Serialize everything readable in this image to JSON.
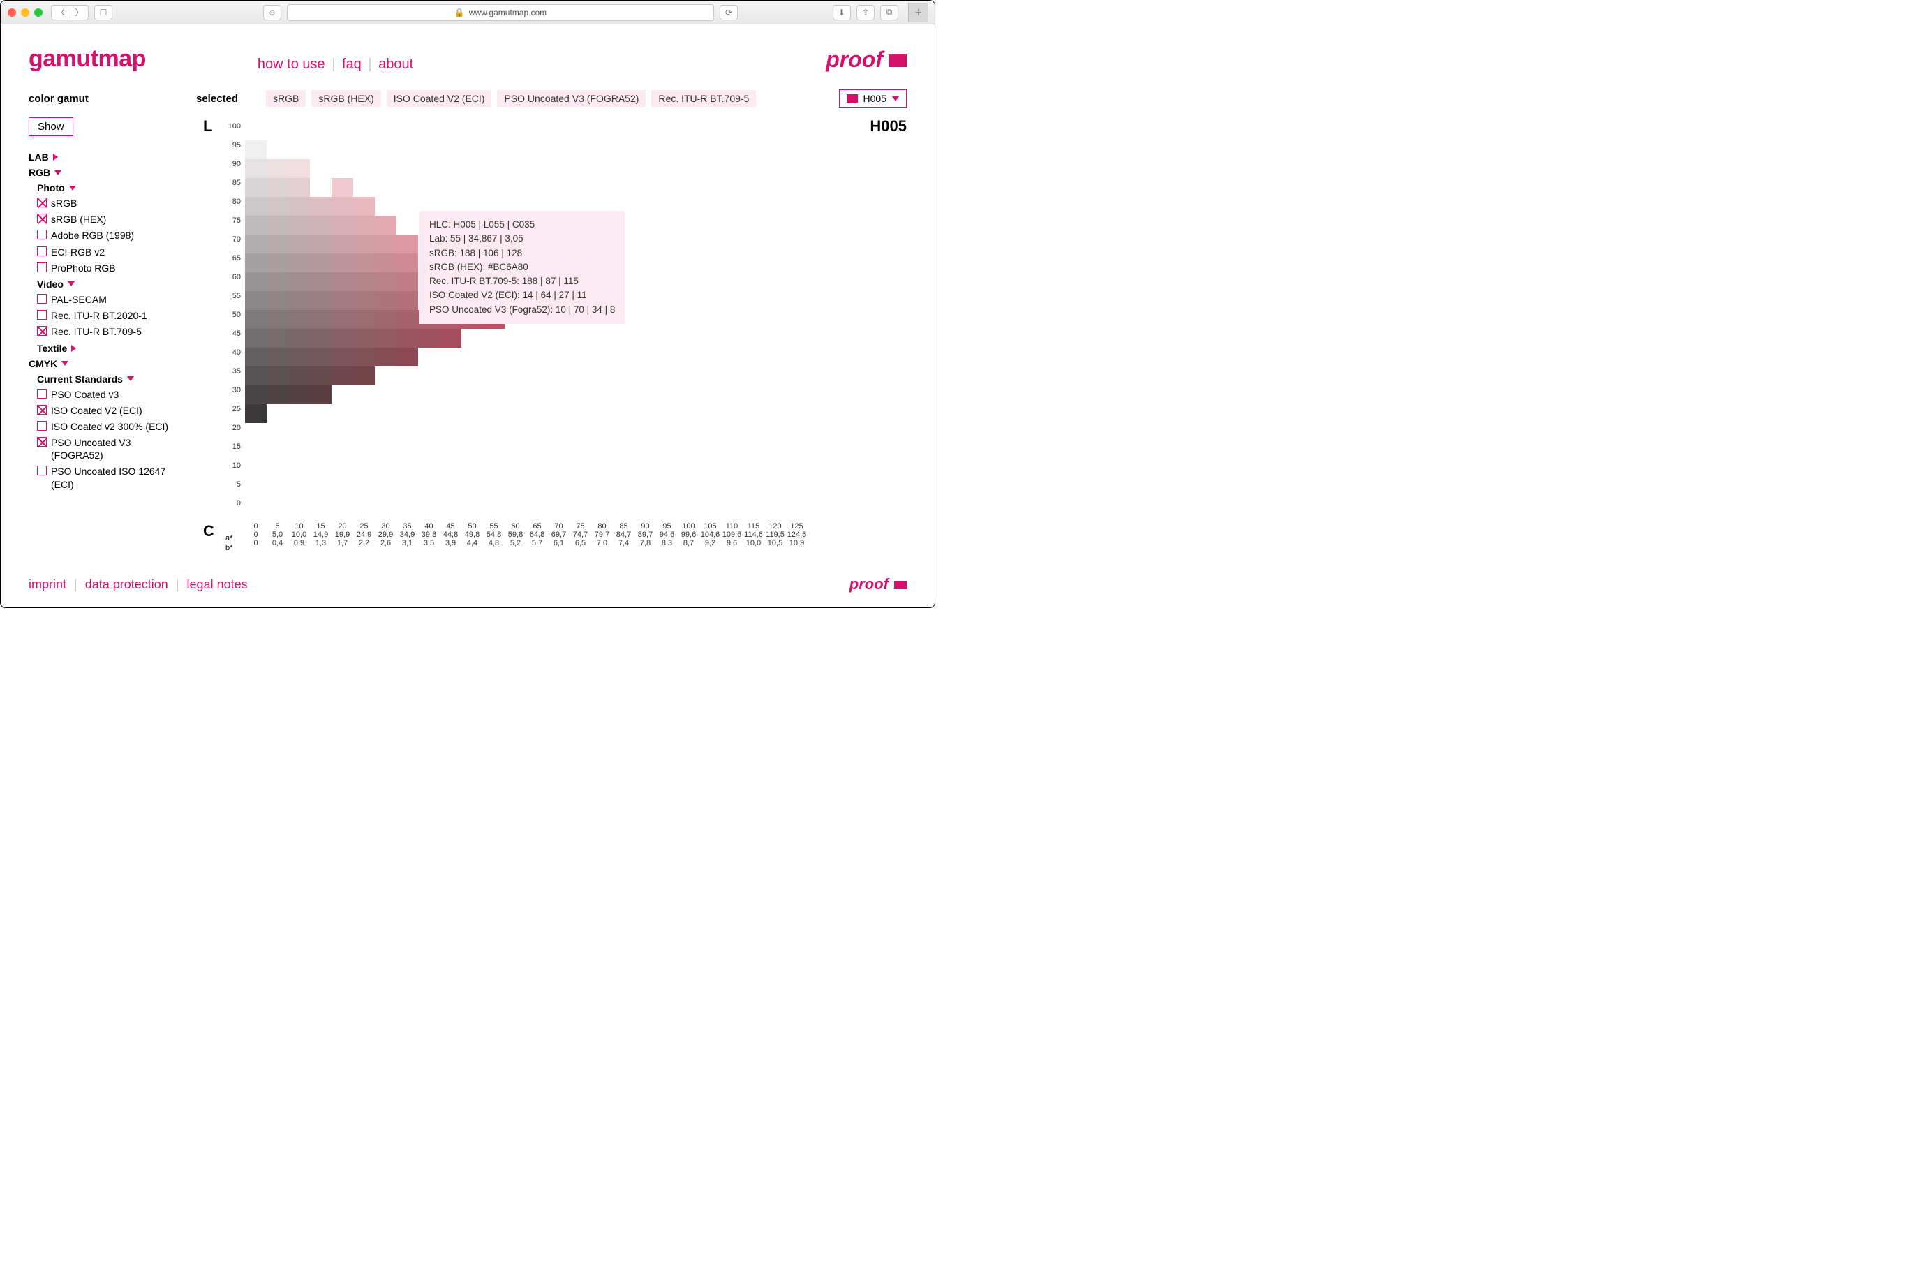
{
  "browser": {
    "url_label": "www.gamutmap.com"
  },
  "header": {
    "logo": "gamutmap",
    "nav": {
      "how": "how to use",
      "faq": "faq",
      "about": "about"
    },
    "brand": "proof"
  },
  "selected_row": {
    "label": "selected",
    "chips": [
      "sRGB",
      "sRGB (HEX)",
      "ISO Coated V2 (ECI)",
      "PSO Uncoated V3 (FOGRA52)",
      "Rec. ITU-R BT.709-5"
    ],
    "dropdown": "H005"
  },
  "sidebar": {
    "title": "color gamut",
    "show": "Show",
    "lab": "LAB",
    "rgb": "RGB",
    "photo": "Photo",
    "photo_items": [
      {
        "label": "sRGB",
        "checked": true
      },
      {
        "label": "sRGB (HEX)",
        "checked": true
      },
      {
        "label": "Adobe RGB (1998)",
        "checked": false
      },
      {
        "label": "ECI-RGB v2",
        "checked": false
      },
      {
        "label": "ProPhoto RGB",
        "checked": false
      }
    ],
    "video": "Video",
    "video_items": [
      {
        "label": "PAL-SECAM",
        "checked": false
      },
      {
        "label": "Rec. ITU-R BT.2020-1",
        "checked": false
      },
      {
        "label": "Rec. ITU-R BT.709-5",
        "checked": true
      }
    ],
    "textile": "Textile",
    "cmyk": "CMYK",
    "standards": "Current Standards",
    "cmyk_items": [
      {
        "label": "PSO Coated v3",
        "checked": false
      },
      {
        "label": "ISO Coated V2 (ECI)",
        "checked": true
      },
      {
        "label": "ISO Coated v2 300% (ECI)",
        "checked": false
      },
      {
        "label": "PSO Uncoated V3 (FOGRA52)",
        "checked": true
      },
      {
        "label": "PSO Uncoated ISO 12647 (ECI)",
        "checked": false
      }
    ]
  },
  "chart": {
    "L_label": "L",
    "C_label": "C",
    "title": "H005",
    "a_label": "a*",
    "b_label": "b*"
  },
  "chart_data": {
    "type": "heatmap",
    "title": "H005",
    "L_ticks": [
      100,
      95,
      90,
      85,
      80,
      75,
      70,
      65,
      60,
      55,
      50,
      45,
      40,
      35,
      30,
      25,
      20,
      15,
      10,
      5,
      0
    ],
    "C_ticks": [
      0,
      5,
      10,
      15,
      20,
      25,
      30,
      35,
      40,
      45,
      50,
      55,
      60,
      65,
      70,
      75,
      80,
      85,
      90,
      95,
      100,
      105,
      110,
      115,
      120,
      125
    ],
    "a_values": [
      "0",
      "5,0",
      "10,0",
      "14,9",
      "19,9",
      "24,9",
      "29,9",
      "34,9",
      "39,8",
      "44,8",
      "49,8",
      "54,8",
      "59,8",
      "64,8",
      "69,7",
      "74,7",
      "79,7",
      "84,7",
      "89,7",
      "94,6",
      "99,6",
      "104,6",
      "109,6",
      "114,6",
      "119,5",
      "124,5"
    ],
    "b_values": [
      "0",
      "0,4",
      "0,9",
      "1,3",
      "1,7",
      "2,2",
      "2,6",
      "3,1",
      "3,5",
      "3,9",
      "4,4",
      "4,8",
      "5,2",
      "5,7",
      "6,1",
      "6,5",
      "7,0",
      "7,4",
      "7,8",
      "8,3",
      "8,7",
      "9,2",
      "9,6",
      "10,0",
      "10,5",
      "10,9"
    ],
    "rows": [
      {
        "L": 95,
        "cells": [
          {
            "c": "#f0f0f0"
          }
        ]
      },
      {
        "L": 90,
        "cells": [
          {
            "c": "#e4e2e2"
          },
          {
            "c": "#ebdfe1"
          },
          {
            "c": "#f1dce0"
          }
        ]
      },
      {
        "L": 85,
        "cells": [
          {
            "c": "#d7d5d5"
          },
          {
            "c": "#ddd2d4"
          },
          {
            "c": "#e3cfd2"
          },
          {
            "c": "#eaccdo"
          },
          {
            "c": "#f0c9cf"
          }
        ]
      },
      {
        "L": 80,
        "cells": [
          {
            "c": "#cac8c8"
          },
          {
            "c": "#d0c5c7"
          },
          {
            "c": "#d6c2c5"
          },
          {
            "c": "#ddbfc3"
          },
          {
            "c": "#e3bcc1"
          },
          {
            "c": "#eab9c0"
          }
        ]
      },
      {
        "L": 75,
        "cells": [
          {
            "c": "#bdbbbb"
          },
          {
            "c": "#c3b8ba"
          },
          {
            "c": "#c9b5b8"
          },
          {
            "c": "#cfb2b6"
          },
          {
            "c": "#d6afb4"
          },
          {
            "c": "#ddacb3"
          },
          {
            "c": "#e4a8b1"
          }
        ]
      },
      {
        "L": 70,
        "cells": [
          {
            "c": "#b0aeae"
          },
          {
            "c": "#b6abad"
          },
          {
            "c": "#bca8ab"
          },
          {
            "c": "#c2a5a9"
          },
          {
            "c": "#c9a2a7"
          },
          {
            "c": "#cf9fa5"
          },
          {
            "c": "#d69ba4"
          },
          {
            "c": "#dd97a2"
          }
        ]
      },
      {
        "L": 65,
        "cells": [
          {
            "c": "#a3a1a1"
          },
          {
            "c": "#a99ea0"
          },
          {
            "c": "#af9b9e"
          },
          {
            "c": "#b5989c"
          },
          {
            "c": "#bb959a"
          },
          {
            "c": "#c29298"
          },
          {
            "c": "#c88e96"
          },
          {
            "c": "#cf8a94"
          }
        ]
      },
      {
        "L": 60,
        "cells": [
          {
            "c": "#969494"
          },
          {
            "c": "#9c9193"
          },
          {
            "c": "#a28e91"
          },
          {
            "c": "#a88b8f"
          },
          {
            "c": "#ae888d"
          },
          {
            "c": "#b4858b"
          },
          {
            "c": "#bb8189"
          },
          {
            "c": "#c17d87"
          }
        ]
      },
      {
        "L": 55,
        "cells": [
          {
            "c": "#898787"
          },
          {
            "c": "#8f8486"
          },
          {
            "c": "#958184"
          },
          {
            "c": "#9b7e82"
          },
          {
            "c": "#a17b80"
          },
          {
            "c": "#a7787e"
          },
          {
            "c": "#ae747c"
          },
          {
            "c": "#b4707a"
          }
        ]
      },
      {
        "L": 50,
        "cells": [
          {
            "c": "#7c7a7a"
          },
          {
            "c": "#827779"
          },
          {
            "c": "#887477"
          },
          {
            "c": "#8e7175"
          },
          {
            "c": "#946e73"
          },
          {
            "c": "#9a6b71"
          },
          {
            "c": "#a0676f"
          },
          {
            "c": "#a7636d"
          },
          {
            "c": "#ad5f6b"
          },
          {
            "c": "#b45a6a"
          },
          {
            "c": "#ba5568"
          },
          {
            "c": "#c14f66"
          }
        ]
      },
      {
        "L": 45,
        "cells": [
          {
            "c": "#6f6d6d"
          },
          {
            "c": "#756a6c"
          },
          {
            "c": "#7b676a"
          },
          {
            "c": "#816468"
          },
          {
            "c": "#876166"
          },
          {
            "c": "#8d5e64"
          },
          {
            "c": "#935a62"
          },
          {
            "c": "#995660"
          },
          {
            "c": "#a0515e"
          },
          {
            "c": "#a64c5c"
          }
        ]
      },
      {
        "L": 40,
        "cells": [
          {
            "c": "#626060"
          },
          {
            "c": "#685d5f"
          },
          {
            "c": "#6e5a5d"
          },
          {
            "c": "#74575b"
          },
          {
            "c": "#7a5459"
          },
          {
            "c": "#805157"
          },
          {
            "c": "#864d55"
          },
          {
            "c": "#8c4953"
          }
        ]
      },
      {
        "L": 35,
        "cells": [
          {
            "c": "#555353"
          },
          {
            "c": "#5b5052"
          },
          {
            "c": "#614d50"
          },
          {
            "c": "#674a4e"
          },
          {
            "c": "#6d474c"
          },
          {
            "c": "#73434a"
          }
        ]
      },
      {
        "L": 30,
        "cells": [
          {
            "c": "#484646"
          },
          {
            "c": "#4e4345"
          },
          {
            "c": "#544043"
          },
          {
            "c": "#5a3d41"
          }
        ]
      },
      {
        "L": 25,
        "cells": [
          {
            "c": "#3b3939"
          }
        ]
      }
    ]
  },
  "tooltip": {
    "l1": "HLC: H005 | L055 | C035",
    "l2": "Lab: 55 | 34,867 | 3,05",
    "l3": "sRGB: 188 | 106 | 128",
    "l4": "sRGB (HEX): #BC6A80",
    "l5": "Rec. ITU-R BT.709-5: 188 | 87 | 115",
    "l6": "ISO Coated V2 (ECI): 14 | 64 | 27 | 11",
    "l7": "PSO Uncoated V3 (Fogra52): 10 | 70 | 34 | 8"
  },
  "footer": {
    "imprint": "imprint",
    "dp": "data protection",
    "legal": "legal notes"
  }
}
